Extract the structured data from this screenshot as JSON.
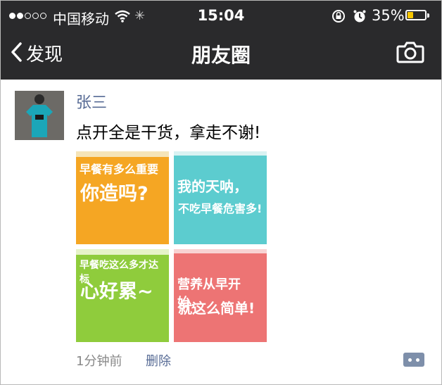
{
  "status_bar": {
    "carrier": "中国移动",
    "time": "15:04",
    "battery_percent": "35%",
    "battery_level": 0.35,
    "signal_dots_filled": 2,
    "signal_dots_total": 5,
    "icons": [
      "wifi-icon",
      "loading-icon",
      "rotation-lock-icon",
      "alarm-icon",
      "battery-icon"
    ]
  },
  "nav": {
    "back_label": "发现",
    "title": "朋友圈",
    "right_icon": "camera-icon"
  },
  "post": {
    "username": "张三",
    "text": "点开全是干货，拿走不谢!",
    "images": [
      {
        "line1": "早餐有多么重要",
        "line2": "你造吗?",
        "color": "#f5a623"
      },
      {
        "line1": "我的天呐，",
        "line2": "不吃早餐危害多!",
        "color": "#5ccccf"
      },
      {
        "line1": "早餐吃这么多才达标",
        "line2": "心好累~",
        "color": "#8fcc3c"
      },
      {
        "line1": "营养从早开始，",
        "line2": "就这么简单!",
        "color": "#ed7474"
      }
    ],
    "time_ago": "1分钟前",
    "delete_label": "删除"
  },
  "colors": {
    "nav_bg": "#2a2a2c",
    "link": "#576b95",
    "battery": "#f7c600"
  }
}
